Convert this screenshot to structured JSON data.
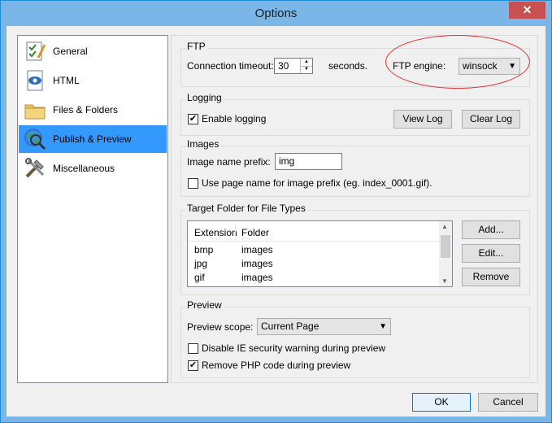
{
  "window": {
    "title": "Options",
    "close_glyph": "✕"
  },
  "sidebar": {
    "items": [
      {
        "label": "General",
        "icon": "general-checklist-icon"
      },
      {
        "label": "HTML",
        "icon": "html-document-icon"
      },
      {
        "label": "Files & Folders",
        "icon": "folder-icon"
      },
      {
        "label": "Publish & Preview",
        "icon": "globe-magnifier-icon",
        "selected": true
      },
      {
        "label": "Miscellaneous",
        "icon": "tools-icon"
      }
    ]
  },
  "ftp": {
    "title": "FTP",
    "timeout_label": "Connection timeout:",
    "timeout_value": "30",
    "seconds_label": "seconds.",
    "engine_label": "FTP engine:",
    "engine_value": "winsock"
  },
  "logging": {
    "title": "Logging",
    "enable_label": "Enable logging",
    "enable_checked": true,
    "view_log": "View Log",
    "clear_log": "Clear Log"
  },
  "images": {
    "title": "Images",
    "prefix_label": "Image name prefix:",
    "prefix_value": "img",
    "use_page_name_label": "Use page name for image prefix (eg. index_0001.gif).",
    "use_page_name_checked": false
  },
  "target_folder": {
    "title": "Target Folder for File Types",
    "columns": [
      "Extension",
      "Folder"
    ],
    "rows": [
      {
        "ext": "bmp",
        "folder": "images"
      },
      {
        "ext": "jpg",
        "folder": "images"
      },
      {
        "ext": "gif",
        "folder": "images"
      }
    ],
    "add": "Add...",
    "edit": "Edit...",
    "remove": "Remove"
  },
  "preview": {
    "title": "Preview",
    "scope_label": "Preview scope:",
    "scope_value": "Current Page",
    "disable_ie_label": "Disable IE security warning during preview",
    "disable_ie_checked": false,
    "remove_php_label": "Remove PHP code during preview",
    "remove_php_checked": true
  },
  "footer": {
    "ok": "OK",
    "cancel": "Cancel"
  },
  "colors": {
    "titlebar": "#7ab7e8",
    "selection": "#3399ff",
    "close": "#c75050",
    "annotation": "#e03030"
  }
}
